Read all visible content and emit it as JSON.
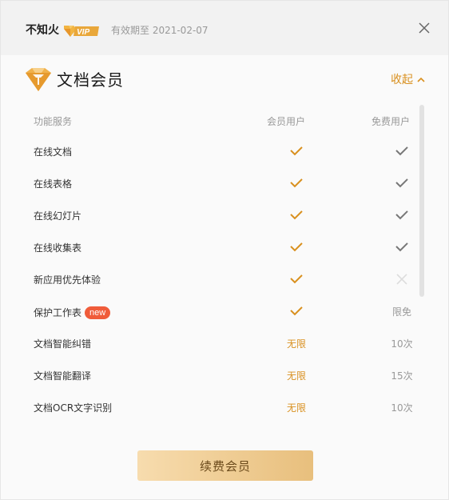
{
  "header": {
    "user_name": "不知火",
    "vip_label": "VIP",
    "expiry": "有效期至 2021-02-07"
  },
  "section": {
    "title": "文档会员",
    "collapse_label": "收起"
  },
  "table": {
    "columns": [
      "功能服务",
      "会员用户",
      "免费用户"
    ],
    "rows": [
      {
        "feature": "在线文档",
        "tag": "",
        "member": "check",
        "free": "check"
      },
      {
        "feature": "在线表格",
        "tag": "",
        "member": "check",
        "free": "check"
      },
      {
        "feature": "在线幻灯片",
        "tag": "",
        "member": "check",
        "free": "check"
      },
      {
        "feature": "在线收集表",
        "tag": "",
        "member": "check",
        "free": "check"
      },
      {
        "feature": "新应用优先体验",
        "tag": "",
        "member": "check",
        "free": "cross"
      },
      {
        "feature": "保护工作表",
        "tag": "new",
        "member": "check",
        "free": "限免"
      },
      {
        "feature": "文档智能纠错",
        "tag": "",
        "member": "无限",
        "free": "10次"
      },
      {
        "feature": "文档智能翻译",
        "tag": "",
        "member": "无限",
        "free": "15次"
      },
      {
        "feature": "文档OCR文字识别",
        "tag": "",
        "member": "无限",
        "free": "10次"
      }
    ]
  },
  "renew_button": "续费会员",
  "colors": {
    "accent": "#d9901f",
    "free_check": "#777777",
    "cross": "#dddddd",
    "new_tag": "#f05c3a"
  }
}
